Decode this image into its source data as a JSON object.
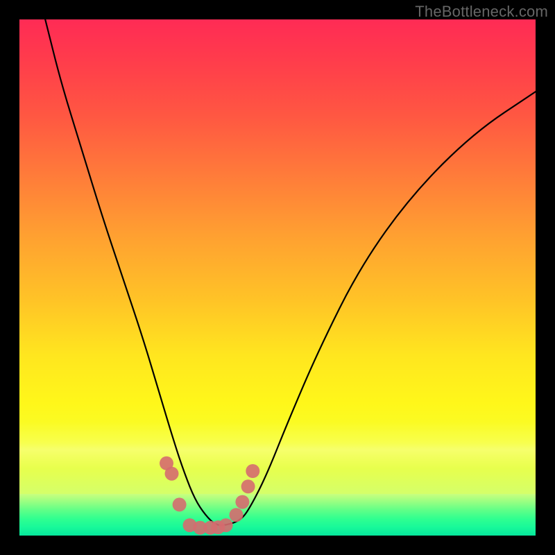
{
  "watermark": "TheBottleneck.com",
  "chart_data": {
    "type": "line",
    "title": "",
    "xlabel": "",
    "ylabel": "",
    "xlim": [
      0,
      100
    ],
    "ylim": [
      0,
      100
    ],
    "series": [
      {
        "name": "bottleneck-curve",
        "x": [
          5,
          8,
          12,
          16,
          20,
          24,
          27,
          30,
          32,
          34,
          36,
          38,
          40,
          43,
          45,
          48,
          52,
          58,
          66,
          76,
          88,
          100
        ],
        "values": [
          100,
          88,
          75,
          62,
          50,
          38,
          28,
          18,
          12,
          7,
          4,
          2,
          2,
          3,
          6,
          12,
          22,
          36,
          52,
          66,
          78,
          86
        ]
      }
    ],
    "markers": {
      "name": "highlight-dots",
      "color": "#d56b6f",
      "x": [
        28.5,
        29.5,
        31,
        33,
        35,
        37,
        38.5,
        40,
        42,
        43.2,
        44.3,
        45.2
      ],
      "values": [
        14,
        12,
        6,
        2,
        1.5,
        1.5,
        1.6,
        2,
        4,
        6.5,
        9.5,
        12.5
      ],
      "radius": 10
    },
    "gradient_stops": [
      {
        "pos": 0.0,
        "color": "#ff2b55"
      },
      {
        "pos": 0.2,
        "color": "#ff5742"
      },
      {
        "pos": 0.45,
        "color": "#ffa031"
      },
      {
        "pos": 0.7,
        "color": "#ffe61f"
      },
      {
        "pos": 0.88,
        "color": "#e9ff4a"
      },
      {
        "pos": 0.95,
        "color": "#95ff82"
      },
      {
        "pos": 1.0,
        "color": "#06e79b"
      }
    ]
  }
}
